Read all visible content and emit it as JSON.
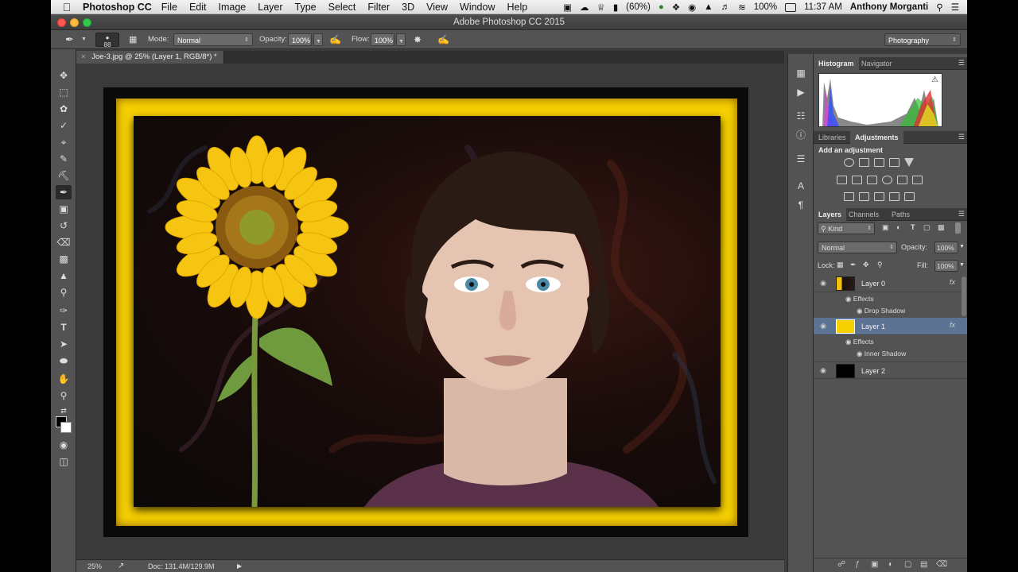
{
  "menubar": {
    "app_name": "Photoshop CC",
    "items": [
      "File",
      "Edit",
      "Image",
      "Layer",
      "Type",
      "Select",
      "Filter",
      "3D",
      "View",
      "Window",
      "Help"
    ],
    "battery": "(60%)",
    "wifi_pct": "100%",
    "time": "11:37 AM",
    "user": "Anthony Morganti"
  },
  "window": {
    "title": "Adobe Photoshop CC 2015"
  },
  "options": {
    "brush_size": "88",
    "mode_label": "Mode:",
    "mode_value": "Normal",
    "opacity_label": "Opacity:",
    "opacity_value": "100%",
    "flow_label": "Flow:",
    "flow_value": "100%",
    "workspace": "Photography"
  },
  "document": {
    "tab_title": "Joe-3.jpg @ 25% (Layer 1, RGB/8*) *"
  },
  "status": {
    "zoom": "25%",
    "doc_size": "Doc: 131.4M/129.9M"
  },
  "panels": {
    "histogram_tab": "Histogram",
    "navigator_tab": "Navigator",
    "libraries_tab": "Libraries",
    "adjustments_tab": "Adjustments",
    "add_adjustment": "Add an adjustment",
    "layers_tab": "Layers",
    "channels_tab": "Channels",
    "paths_tab": "Paths",
    "kind_filter": "Kind",
    "blend_mode": "Normal",
    "opacity_label": "Opacity:",
    "opacity_value": "100%",
    "lock_label": "Lock:",
    "fill_label": "Fill:",
    "fill_value": "100%",
    "layers": [
      {
        "name": "Layer 0",
        "effects_label": "Effects",
        "effect": "Drop Shadow"
      },
      {
        "name": "Layer 1",
        "effects_label": "Effects",
        "effect": "Inner Shadow"
      },
      {
        "name": "Layer 2"
      }
    ],
    "fx_symbol": "fx"
  },
  "colors": {
    "frame_yellow": "#f7d000",
    "layer_selected": "#5d7394",
    "ui_panel": "#535353"
  }
}
